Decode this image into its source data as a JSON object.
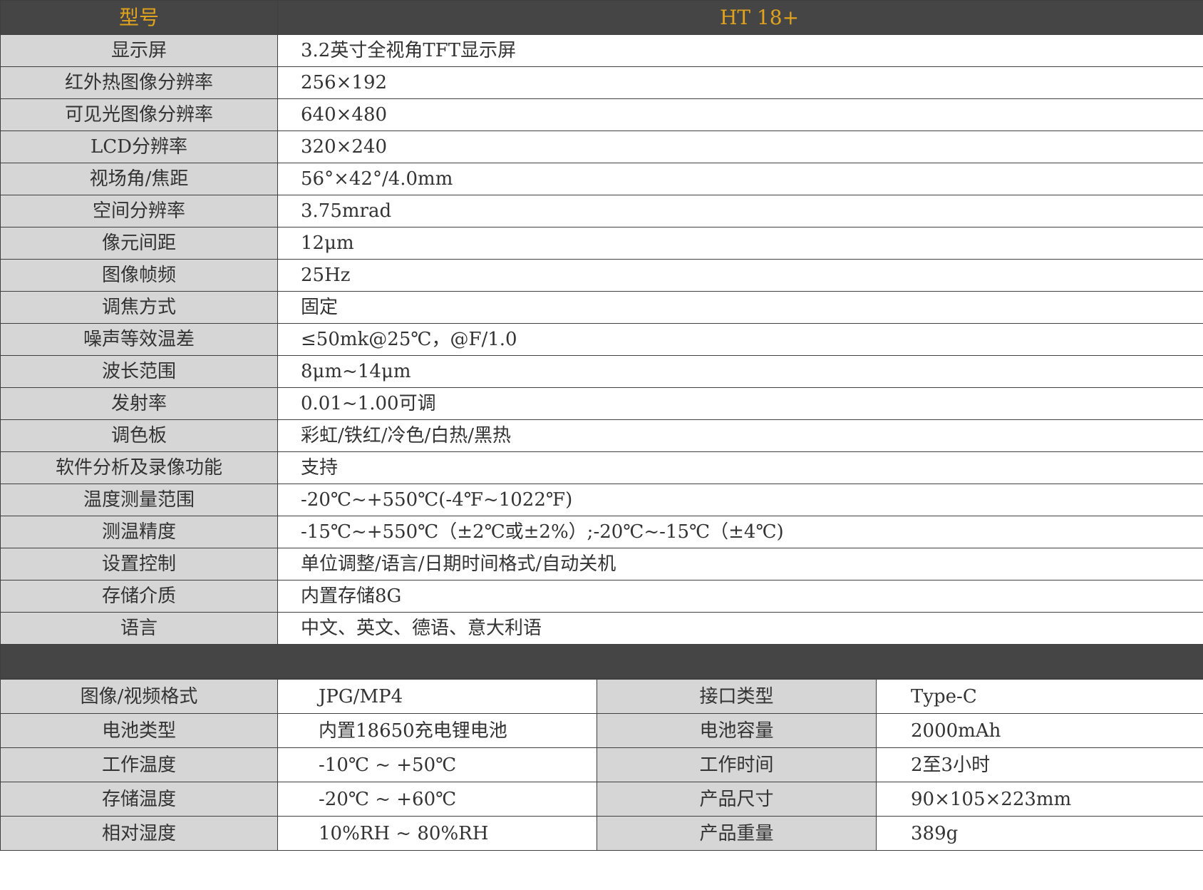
{
  "header": {
    "label": "型号",
    "value": "HT 18+"
  },
  "specs": [
    {
      "label": "显示屏",
      "value": "3.2英寸全视角TFT显示屏"
    },
    {
      "label": "红外热图像分辨率",
      "value": "256×192"
    },
    {
      "label": "可见光图像分辨率",
      "value": "640×480"
    },
    {
      "label": "LCD分辨率",
      "value": "320×240"
    },
    {
      "label": "视场角/焦距",
      "value": "56°×42°/4.0mm"
    },
    {
      "label": "空间分辨率",
      "value": "3.75mrad"
    },
    {
      "label": "像元间距",
      "value": "12μm"
    },
    {
      "label": "图像帧频",
      "value": "25Hz"
    },
    {
      "label": "调焦方式",
      "value": "固定"
    },
    {
      "label": "噪声等效温差",
      "value": "≤50mk@25℃，@F/1.0"
    },
    {
      "label": "波长范围",
      "value": "8μm~14μm"
    },
    {
      "label": "发射率",
      "value": "0.01~1.00可调"
    },
    {
      "label": "调色板",
      "value": "彩虹/铁红/冷色/白热/黑热"
    },
    {
      "label": "软件分析及录像功能",
      "value": "支持"
    },
    {
      "label": "温度测量范围",
      "value": "-20℃~+550℃(-4℉~1022℉)"
    },
    {
      "label": "测温精度",
      "value": "-15℃~+550℃（±2℃或±2%）;-20℃~-15℃（±4℃)"
    },
    {
      "label": "设置控制",
      "value": "单位调整/语言/日期时间格式/自动关机"
    },
    {
      "label": "存储介质",
      "value": "内置存储8G"
    },
    {
      "label": "语言",
      "value": "中文、英文、德语、意大利语"
    }
  ],
  "specs2": [
    {
      "label1": "图像/视频格式",
      "value1": "JPG/MP4",
      "label2": "接口类型",
      "value2": "Type-C"
    },
    {
      "label1": "电池类型",
      "value1": "内置18650充电锂电池",
      "label2": "电池容量",
      "value2": "2000mAh"
    },
    {
      "label1": "工作温度",
      "value1": "-10℃ ~ +50℃",
      "label2": "工作时间",
      "value2": "2至3小时"
    },
    {
      "label1": "存储温度",
      "value1": "-20℃ ~ +60℃",
      "label2": "产品尺寸",
      "value2": "90×105×223mm"
    },
    {
      "label1": "相对湿度",
      "value1": "10%RH ~ 80%RH",
      "label2": "产品重量",
      "value2": "389g"
    }
  ],
  "colors": {
    "header_bg": "#454545",
    "header_text": "#e0a31e",
    "label_bg": "#d6d6d6"
  }
}
